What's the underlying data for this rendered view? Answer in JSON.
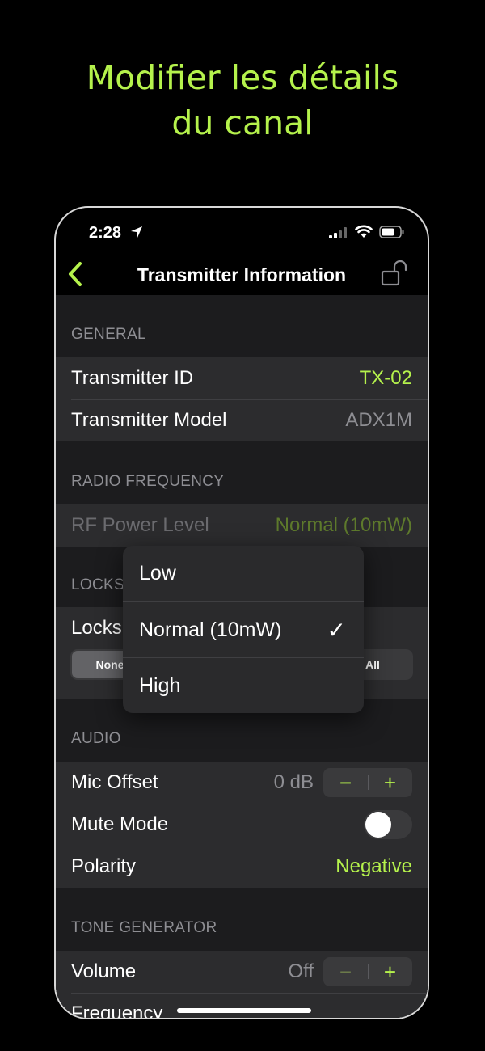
{
  "headline": {
    "line1": "Modifier les détails",
    "line2": "du canal"
  },
  "status_bar": {
    "time": "2:28"
  },
  "navbar": {
    "title": "Transmitter Information"
  },
  "sections": {
    "general": {
      "header": "GENERAL",
      "transmitter_id": {
        "label": "Transmitter ID",
        "value": "TX-02"
      },
      "transmitter_model": {
        "label": "Transmitter Model",
        "value": "ADX1M"
      }
    },
    "radio_frequency": {
      "header": "RADIO FREQUENCY",
      "rf_power_level": {
        "label": "RF Power Level",
        "value": "Normal (10mW)"
      }
    },
    "locks": {
      "header": "LOCKS",
      "locks_label": "Locks",
      "segments": [
        "None",
        "All"
      ],
      "selected": "None"
    },
    "audio": {
      "header": "AUDIO",
      "mic_offset": {
        "label": "Mic Offset",
        "value": "0 dB",
        "minus": "−",
        "plus": "+"
      },
      "mute_mode": {
        "label": "Mute Mode",
        "on": false
      },
      "polarity": {
        "label": "Polarity",
        "value": "Negative"
      }
    },
    "tone_generator": {
      "header": "TONE GENERATOR",
      "volume": {
        "label": "Volume",
        "value": "Off",
        "minus": "−",
        "plus": "+"
      },
      "frequency": {
        "label": "Frequency"
      }
    }
  },
  "dropdown_menu": {
    "options": [
      "Low",
      "Normal (10mW)",
      "High"
    ],
    "selected": "Normal (10mW)",
    "check_mark": "✓"
  },
  "colors": {
    "accent": "#b5f24c",
    "background": "#1c1c1e",
    "cell": "#2c2c2e"
  }
}
